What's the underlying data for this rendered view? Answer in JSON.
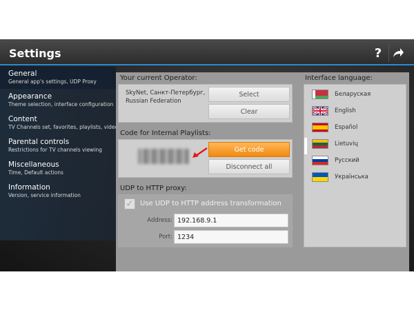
{
  "header": {
    "title": "Settings",
    "help_label": "?",
    "forward_label": "➦"
  },
  "sidebar": {
    "items": [
      {
        "label": "General",
        "desc": "General app's settings, UDP Proxy",
        "active": true
      },
      {
        "label": "Appearance",
        "desc": "Theme selection, interface configuration"
      },
      {
        "label": "Content",
        "desc": "TV Channels set, favorites, playlists, video"
      },
      {
        "label": "Parental controls",
        "desc": "Restrictions for TV channels viewing"
      },
      {
        "label": "Miscellaneous",
        "desc": "Time, Default actions"
      },
      {
        "label": "Information",
        "desc": "Version, service information"
      }
    ]
  },
  "operator": {
    "title": "Your current Operator:",
    "name": "SkyNet, Санкт-Петербург, Russian Federation",
    "select_label": "Select",
    "clear_label": "Clear"
  },
  "playlists": {
    "title": "Code for Internal Playlists:",
    "get_code_label": "Get code",
    "disconnect_label": "Disconnect all"
  },
  "udp": {
    "title": "UDP to HTTP proxy:",
    "checkbox_label": "Use UDP to HTTP address transformation",
    "checked": true,
    "address_label": "Address:",
    "address_value": "192.168.9.1",
    "port_label": "Port:",
    "port_value": "1234"
  },
  "language": {
    "title": "Interface language:",
    "items": [
      {
        "label": "Беларуская",
        "flag": "belarus-flag"
      },
      {
        "label": "English",
        "flag": "uk-flag"
      },
      {
        "label": "Español",
        "flag": "spain-flag"
      },
      {
        "label": "Lietuvių",
        "flag": "lithuania-flag"
      },
      {
        "label": "Русский",
        "flag": "russia-flag"
      },
      {
        "label": "Українська",
        "flag": "ukraine-flag"
      }
    ]
  },
  "colors": {
    "accent": "#2a8bd6",
    "orange_button": "#f59a1f"
  }
}
